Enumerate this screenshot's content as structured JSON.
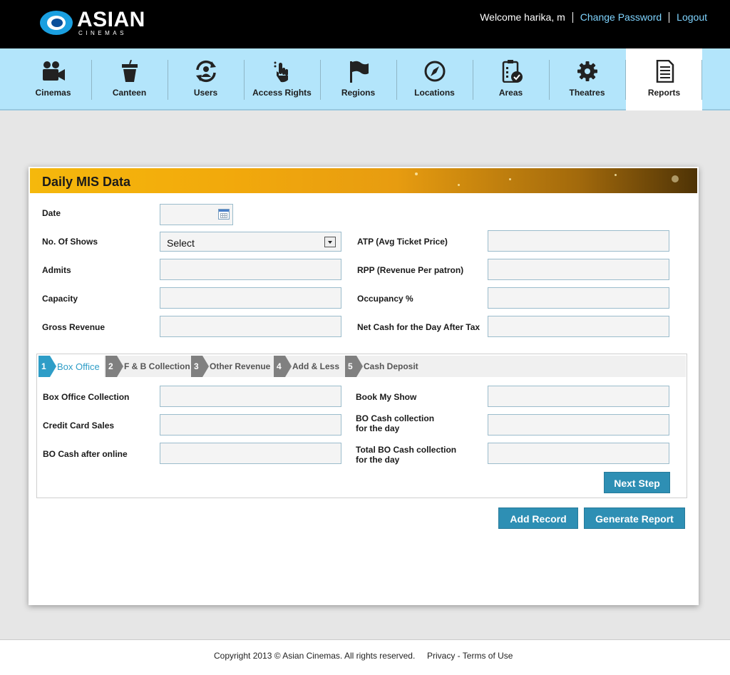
{
  "brand": {
    "name": "ASIAN",
    "tagline": "CINEMAS"
  },
  "header": {
    "welcome": "Welcome harika, m",
    "change_password": "Change Password",
    "logout": "Logout"
  },
  "nav": {
    "items": [
      {
        "label": "Cinemas",
        "icon": "camera-icon"
      },
      {
        "label": "Canteen",
        "icon": "cup-icon"
      },
      {
        "label": "Users",
        "icon": "users-sync-icon"
      },
      {
        "label": "Access Rights",
        "icon": "hand-pointer-icon"
      },
      {
        "label": "Regions",
        "icon": "flag-icon"
      },
      {
        "label": "Locations",
        "icon": "compass-icon"
      },
      {
        "label": "Areas",
        "icon": "clipboard-check-icon"
      },
      {
        "label": "Theatres",
        "icon": "gear-icon"
      },
      {
        "label": "Reports",
        "icon": "document-icon",
        "active": true
      }
    ]
  },
  "panel": {
    "title": "Daily MIS Data",
    "left_fields": {
      "date": "Date",
      "shows": "No. Of Shows",
      "shows_value": "Select",
      "admits": "Admits",
      "capacity": "Capacity",
      "gross": "Gross Revenue"
    },
    "right_fields": {
      "atp": "ATP (Avg Ticket Price)",
      "rpp": "RPP (Revenue Per patron)",
      "occupancy": "Occupancy %",
      "netcash": "Net Cash for the Day After Tax"
    }
  },
  "wizard": {
    "steps": [
      {
        "num": "1",
        "label": "Box Office",
        "active": true
      },
      {
        "num": "2",
        "label": "F & B Collection"
      },
      {
        "num": "3",
        "label": "Other Revenue"
      },
      {
        "num": "4",
        "label": "Add & Less"
      },
      {
        "num": "5",
        "label": "Cash Deposit"
      }
    ],
    "fields": {
      "box_office_collection": "Box Office Collection",
      "credit_card_sales": "Credit Card Sales",
      "bo_cash_after_online": "BO Cash after online",
      "book_my_show": "Book My Show",
      "bo_cash_line1": "BO Cash collection",
      "bo_cash_line2": "for the day",
      "total_bo_line1": "Total BO Cash collection",
      "total_bo_line2": "for the day"
    },
    "next_step": "Next Step"
  },
  "actions": {
    "add_record": "Add Record",
    "generate_report": "Generate Report"
  },
  "footer": {
    "copyright": "Copyright 2013 © Asian Cinemas. All rights reserved.",
    "privacy": "Privacy",
    "dash": " - ",
    "terms": "Terms of Use"
  },
  "colors": {
    "accent": "#2e8fb4",
    "nav_bg": "#b3e5fb",
    "header_bg": "#000000",
    "panel_head": "#f2a90c"
  }
}
